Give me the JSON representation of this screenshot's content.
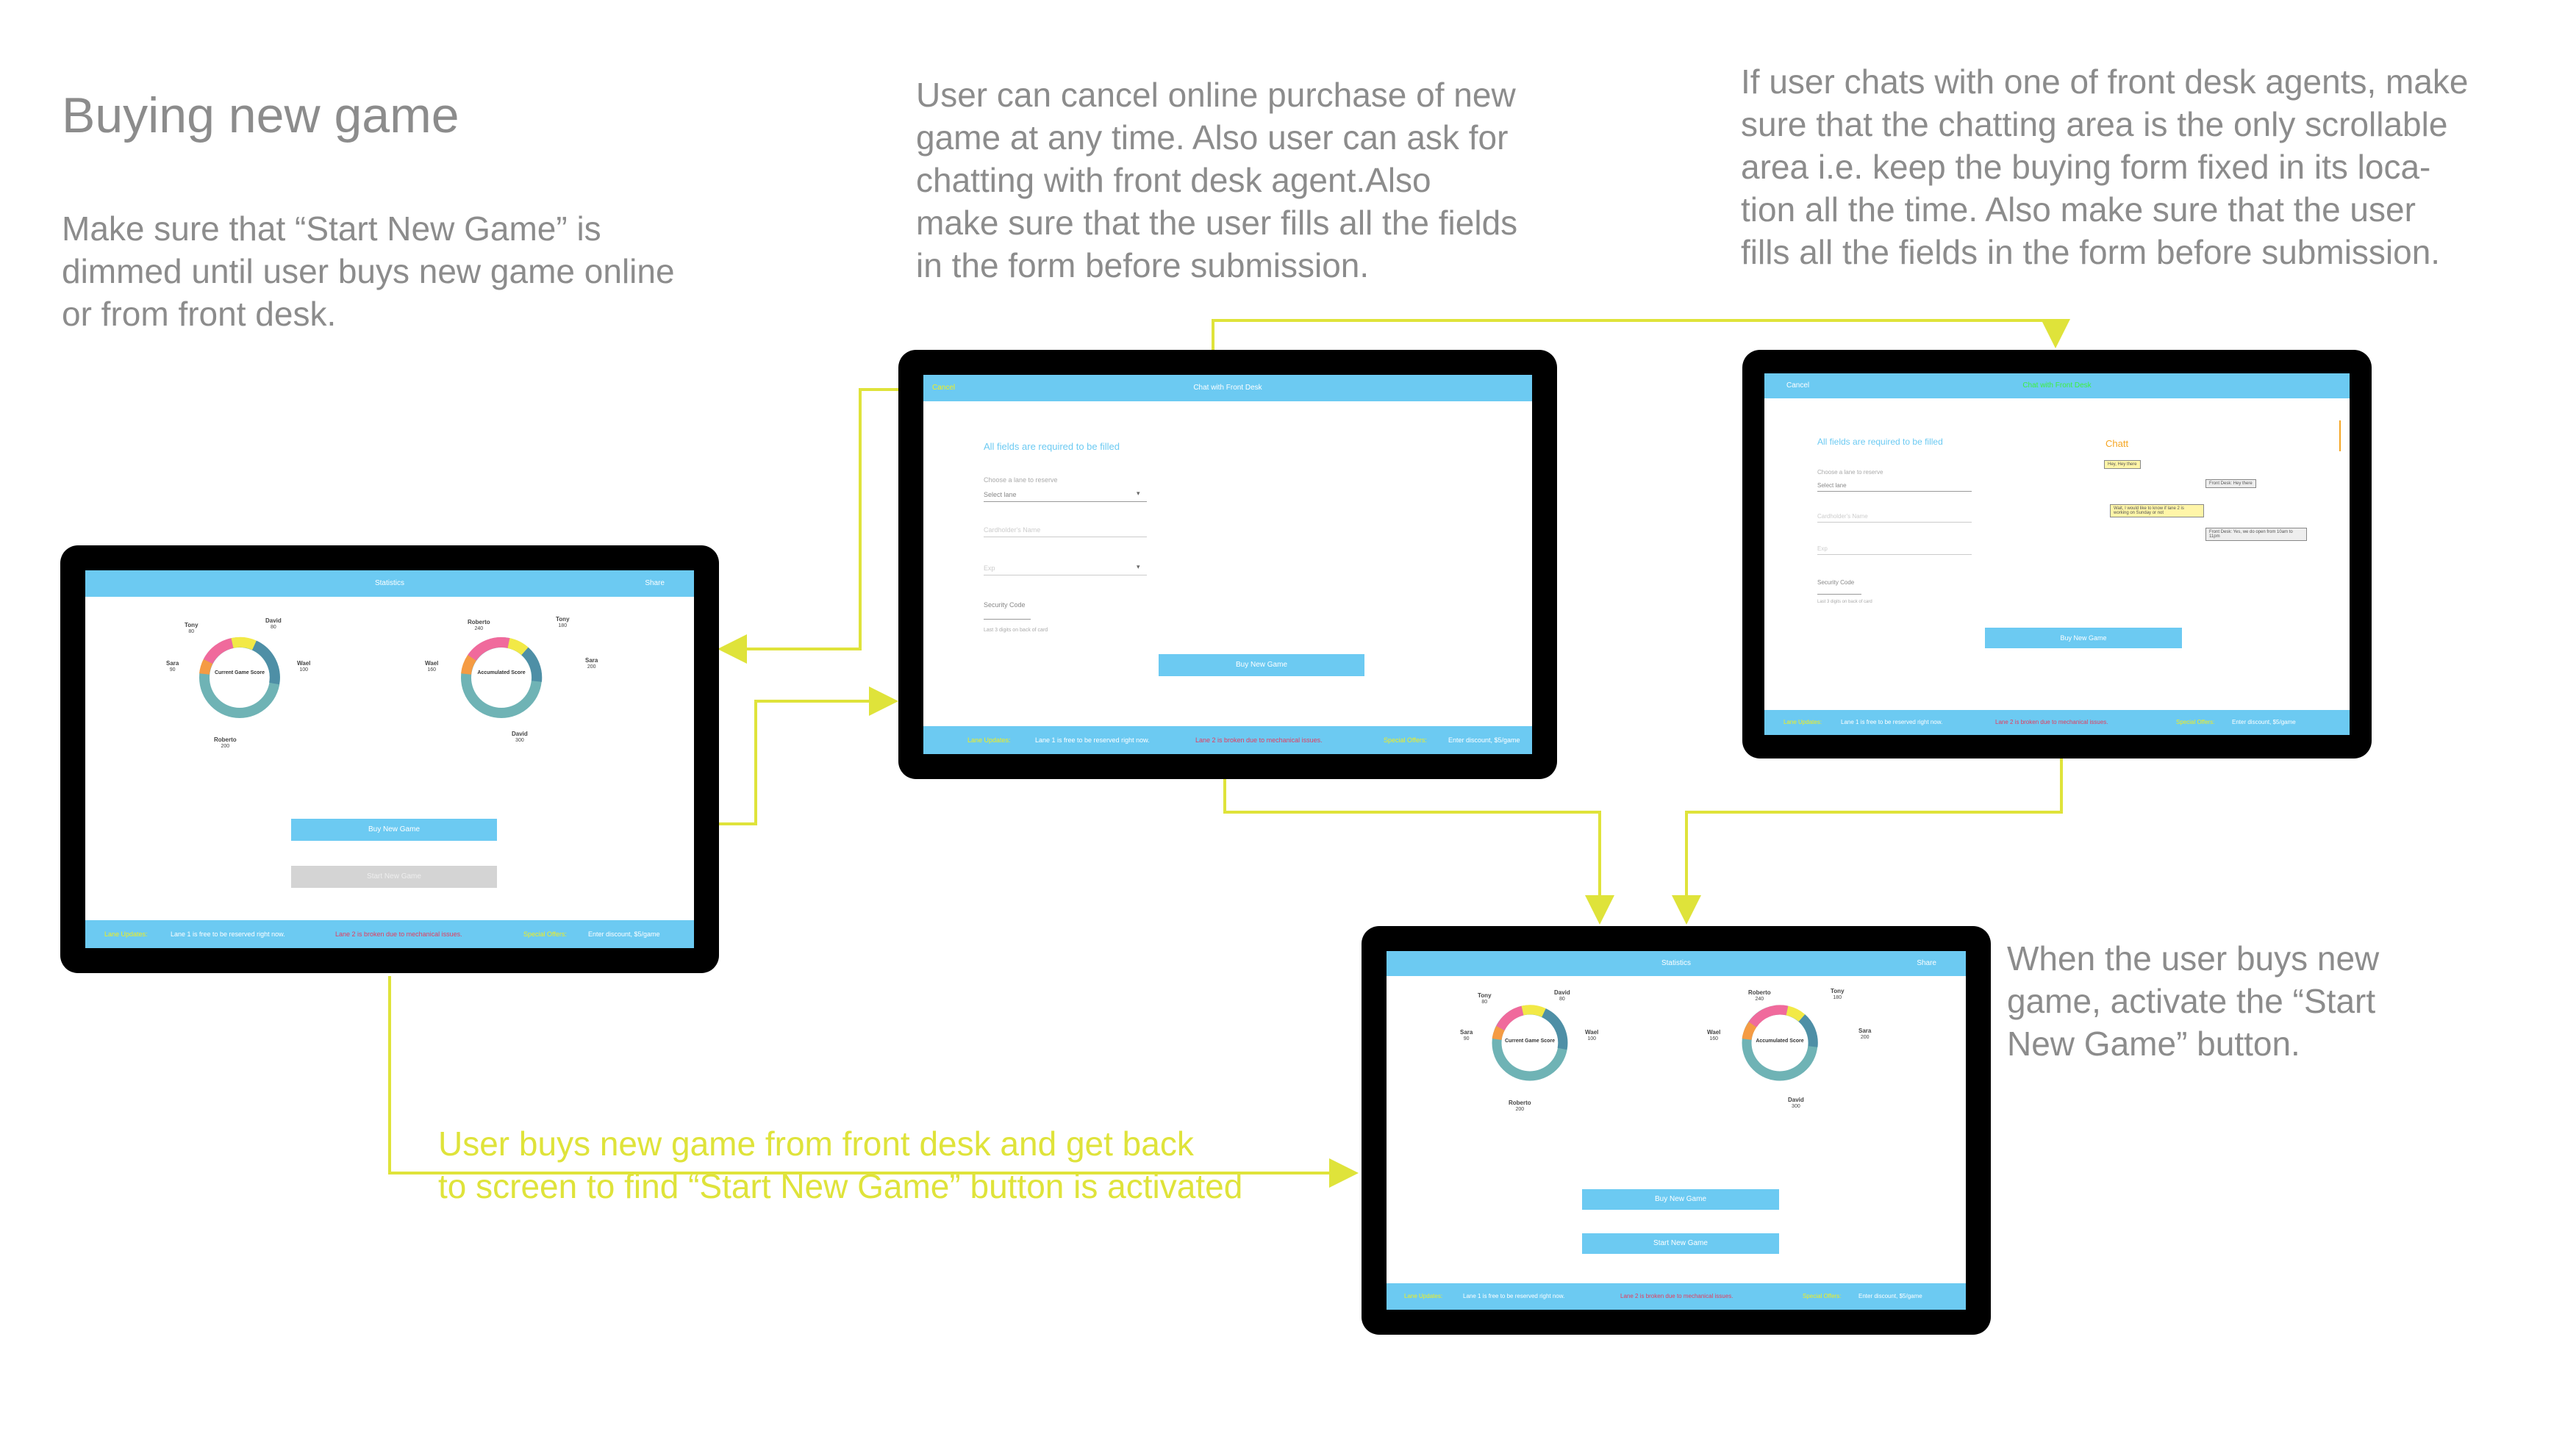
{
  "heading": "Buying new game",
  "notes": {
    "dim_rule": "Make sure that “Start New Game” is\ndimmed until user buys new game online\nor from front desk.",
    "cancel_rule": "User can cancel online purchase of new\ngame at any time. Also user can ask for\nchatting with front desk agent.Also\nmake sure that the user fills all the fields\nin the form before submission.",
    "chat_rule": "If user chats with one of front desk agents, make\nsure that the chatting area is the only scrollable\narea i.e. keep the buying form fixed in its loca-\ntion all the time. Also make sure that the user\nfills all the fields in the form before submission.",
    "activate_rule": "When the user buys new\ngame, activate the “Start\nNew Game” button.",
    "front_desk_flow": "User buys new game from front desk and get back\nto screen to find “Start New Game” button is activated"
  },
  "colors": {
    "accent": "#6ccaf2",
    "connector": "#dfe33a",
    "frame": "#000000"
  },
  "statistics_screen": {
    "title": "Statistics",
    "share": "Share",
    "current_chart": {
      "center": "Current Game\nScore",
      "players": [
        {
          "name": "Tony",
          "score": "80"
        },
        {
          "name": "David",
          "score": "80"
        },
        {
          "name": "Wael",
          "score": "100"
        },
        {
          "name": "Roberto",
          "score": "200"
        },
        {
          "name": "Sara",
          "score": "90"
        }
      ]
    },
    "accumulated_chart": {
      "center": "Accumulated\nScore",
      "players": [
        {
          "name": "Roberto",
          "score": "240"
        },
        {
          "name": "Tony",
          "score": "180"
        },
        {
          "name": "Sara",
          "score": "200"
        },
        {
          "name": "David",
          "score": "300"
        },
        {
          "name": "Wael",
          "score": "160"
        }
      ]
    },
    "buy_button": "Buy New Game",
    "start_button": "Start New Game"
  },
  "footer": {
    "lane_updates": "Lane Updates:",
    "lane1": "Lane 1 is free to be reserved right now.",
    "lane2": "Lane 2 is broken due to mechanical issues.",
    "special_offers": "Special Offers:",
    "discount": "Enter  discount, $5/game"
  },
  "purchase_screen": {
    "cancel": "Cancel",
    "chat_link": "Chat with Front Desk",
    "form_title": "All fields are required to be filled",
    "lane_label": "Choose a lane to reserve",
    "lane_value": "Select lane",
    "cardholder": "Cardholder's Name",
    "expiry": "Exp",
    "security_label": "Security Code",
    "security_hint": "Last 3 digits on back of card",
    "buy_button": "Buy New Game"
  },
  "chat_screen": {
    "cancel": "Cancel",
    "title": "Chat with Front Desk",
    "chat_title": "Chatt",
    "messages": [
      {
        "text": "Hey, Hey there"
      },
      {
        "text": "Front Desk: Hey there"
      },
      {
        "text": "Wait, I would like to know if lane 2"
      },
      {
        "text": "is working on Sunday or not"
      },
      {
        "text": "Front Desk: Yes, we do open"
      },
      {
        "text": "from 10am to 11pm"
      }
    ]
  }
}
